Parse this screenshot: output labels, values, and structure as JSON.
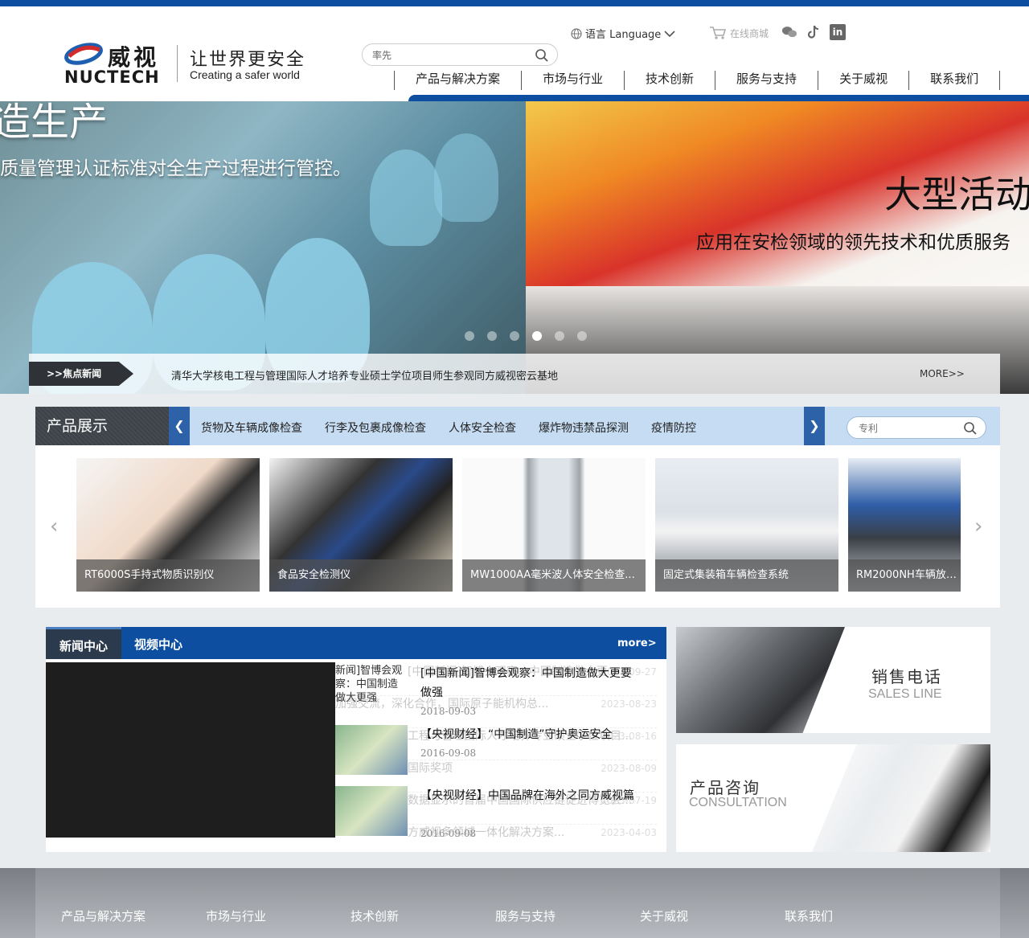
{
  "header": {
    "logo_cn": "威视",
    "logo_en": "NUCTECH",
    "slogan_cn": "让世界更安全",
    "slogan_en": "Creating a safer world",
    "language_label": "语言 Language",
    "shop_label": "在线商城",
    "search_value": "率先",
    "nav": [
      "产品与解决方案",
      "市场与行业",
      "技术创新",
      "服务与支持",
      "关于威视",
      "联系我们"
    ]
  },
  "banner": {
    "left_title": "造生产",
    "left_subtitle": "质量管理认证标准对全生产过程进行管控。",
    "right_title": "大型活动",
    "right_subtitle": "应用在安检领域的领先技术和优质服务",
    "slides_count": 6,
    "active_slide": 4
  },
  "focus_news": {
    "tag": ">>焦点新闻",
    "text": "清华大学核电工程与管理国际人才培养专业硕士学位项目师生参观同方威视密云基地",
    "more": "MORE>>"
  },
  "products": {
    "title": "产品展示",
    "categories": [
      "货物及车辆成像检查",
      "行李及包裹成像检查",
      "人体安全检查",
      "爆炸物违禁品探测",
      "疫情防控"
    ],
    "search_placeholder": "专利",
    "items": [
      {
        "name": "RT6000S手持式物质识别仪"
      },
      {
        "name": "食品安全检测仪"
      },
      {
        "name": "MW1000AA毫米波人体安全检查..."
      },
      {
        "name": "固定式集装箱车辆检查系统"
      },
      {
        "name": "RM2000NH车辆放射性..."
      }
    ]
  },
  "news_center": {
    "tab_news": "新闻中心",
    "tab_video": "视频中心",
    "more": "more>",
    "left_sliver_text": "新闻]智博会观察：中国制造做大更强",
    "background_lines": [
      {
        "text": "[中国新闻]智博会观察：中国制造做大更",
        "date": "2023-09-27"
      },
      {
        "text": "加强交流，深化合作，国际原子能机构总...",
        "date": "2023-08-23"
      },
      {
        "text": "工程与管理国际人才培养专业硕士学位项目...",
        "date": "2023-08-16"
      },
      {
        "text": "国际奖项",
        "date": "2023-08-09"
      },
      {
        "text": "数据显示的首届中国国际供应链促进博览会...",
        "date": "2023-07-19"
      },
      {
        "text": "方威视多领域一体化解决方案...",
        "date": "2023-04-03"
      }
    ],
    "videos": [
      {
        "title": "[中国新闻]智博会观察：中国制造做大更要做强",
        "date": "2018-09-03"
      },
      {
        "title": "【央视财经】“中国制造”守护奥运安全",
        "date": "2016-09-08"
      },
      {
        "title": "【央视财经】中国品牌在海外之同方威视篇",
        "date": "2016-09-08"
      }
    ]
  },
  "side_panels": {
    "sales_cn": "销售电话",
    "sales_en": "SALES LINE",
    "consult_cn": "产品咨询",
    "consult_en": "CONSULTATION"
  },
  "footer": {
    "nav": [
      "产品与解决方案",
      "市场与行业",
      "技术创新",
      "服务与支持",
      "关于威视",
      "联系我们"
    ]
  },
  "colors": {
    "brand_blue": "#0d4ea0",
    "nav_dark": "#2b3a4c",
    "category_bar": "#c6dcf2"
  }
}
